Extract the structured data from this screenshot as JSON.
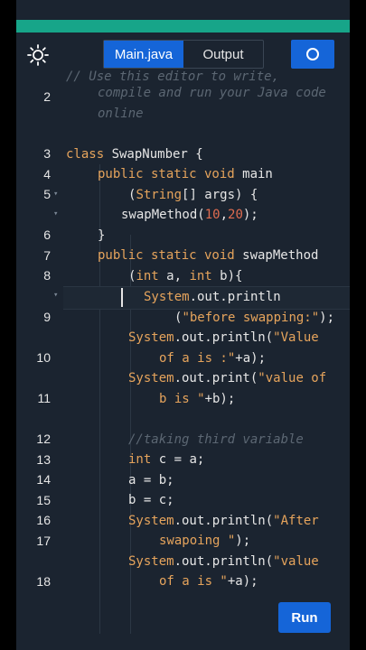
{
  "toolbar": {
    "theme_icon": "sun-icon",
    "tabs": [
      {
        "label": "Main.java",
        "active": true
      },
      {
        "label": "Output",
        "active": false
      }
    ],
    "run_icon": "circle-icon"
  },
  "editor": {
    "line_numbers": [
      "2",
      "3",
      "4",
      "5",
      "6",
      "7",
      "8",
      "9",
      "10",
      "11",
      "12",
      "13",
      "14",
      "15",
      "16",
      "17",
      "18"
    ],
    "comment_lines": [
      "// Use this editor to write,",
      "compile and run your Java code",
      "online"
    ],
    "code": {
      "l4": [
        "class ",
        "SwapNumber",
        " {"
      ],
      "l5a": [
        "public static void",
        " main"
      ],
      "l5b": [
        "(",
        "String",
        "[] args) {"
      ],
      "l6": [
        "swapMethod(",
        "10",
        ",",
        "20",
        ");"
      ],
      "l7": "}",
      "l8a": [
        "public static void",
        " swapMethod"
      ],
      "l8b": [
        "(",
        "int",
        " a, ",
        "int",
        " b){"
      ],
      "l9a": [
        "System",
        ".out.println"
      ],
      "l9b": [
        "(",
        "\"before swapping:\"",
        ");"
      ],
      "l10a": [
        "System",
        ".out.println(",
        "\"Value"
      ],
      "l10b": [
        "of a is :\"",
        "+a);"
      ],
      "l11a": [
        "System",
        ".out.print(",
        "\"value of"
      ],
      "l11b": [
        "b is \"",
        "+b);"
      ],
      "l13": "//taking third variable",
      "l14": [
        "int",
        " c = a;"
      ],
      "l15": "a = b;",
      "l16": "b = c;",
      "l17a": [
        "System",
        ".out.println(",
        "\"After"
      ],
      "l17b": [
        "swapoing \"",
        ");"
      ],
      "l18a": [
        "System",
        ".out.println(",
        "\"value"
      ],
      "l18b": [
        "of a is \"",
        "+a);"
      ]
    }
  },
  "run_button": {
    "label": "Run"
  }
}
